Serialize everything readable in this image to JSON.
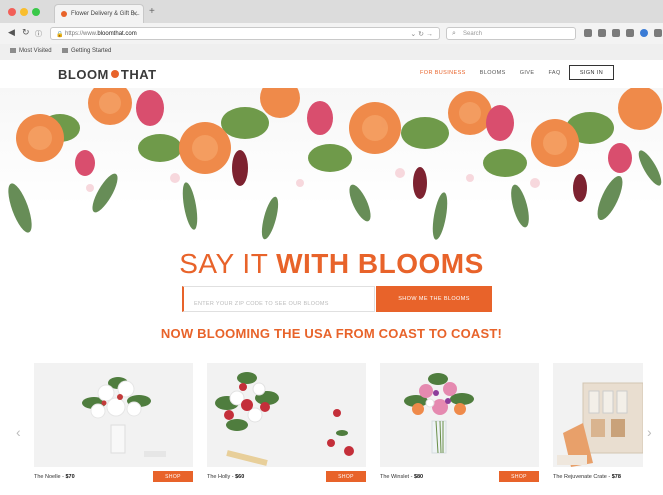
{
  "browser": {
    "tab_title": "Flower Delivery & Gift B...",
    "url_prefix": "https://www.",
    "url_host": "bloomthat.com",
    "search_placeholder": "Search",
    "bookmarks": [
      "Most Visited",
      "Getting Started"
    ]
  },
  "site": {
    "logo_left": "BLOOM",
    "logo_right": "THAT",
    "nav": [
      "FOR BUSINESS",
      "BLOOMS",
      "GIVE",
      "FAQ"
    ],
    "sign_in": "SIGN IN",
    "accent_color": "#e8632a"
  },
  "hero": {
    "headline_light": "SAY IT ",
    "headline_bold": "WITH BLOOMS",
    "input_placeholder": "ENTER YOUR ZIP CODE TO SEE OUR BLOOMS",
    "cta": "SHOW ME THE BLOOMS",
    "tagline": "NOW BLOOMING THE USA FROM COAST TO COAST!"
  },
  "products": [
    {
      "name": "The Noelle",
      "price": "$70",
      "shop": "SHOP"
    },
    {
      "name": "The Holly",
      "price": "$60",
      "shop": "SHOP"
    },
    {
      "name": "The Winslet",
      "price": "$80",
      "shop": "SHOP"
    },
    {
      "name": "The Rejuvenate Crate",
      "price": "$78",
      "shop": ""
    }
  ]
}
